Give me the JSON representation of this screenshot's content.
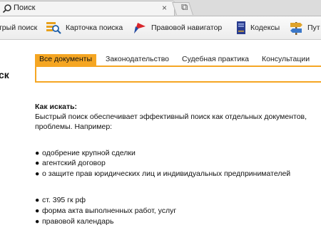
{
  "tab": {
    "title": "Поиск",
    "close": "×",
    "new_tab": "⧉"
  },
  "toolbar": {
    "items": [
      {
        "label": "трый поиск"
      },
      {
        "label": "Карточка поиска"
      },
      {
        "label": "Правовой навигатор"
      },
      {
        "label": "Кодексы"
      },
      {
        "label": "Пут"
      }
    ]
  },
  "side_heading": "ск",
  "search": {
    "tabs": [
      "Все документы",
      "Законодательство",
      "Судебная практика",
      "Консультации"
    ],
    "value": ""
  },
  "help": {
    "title": "Как искать:",
    "line1": "Быстрый поиск обеспечивает эффективный поиск как отдельных документов,",
    "line2": "проблемы. Например:",
    "group1": [
      "одобрение крупной сделки",
      "агентский договор",
      "о защите прав юридических лиц и индивидуальных предпринимателей"
    ],
    "group2": [
      "ст. 395 гк рф",
      "форма акта выполненных работ, услуг",
      "правовой календарь"
    ],
    "bullet": "●"
  },
  "colors": {
    "accent": "#f5a623"
  }
}
